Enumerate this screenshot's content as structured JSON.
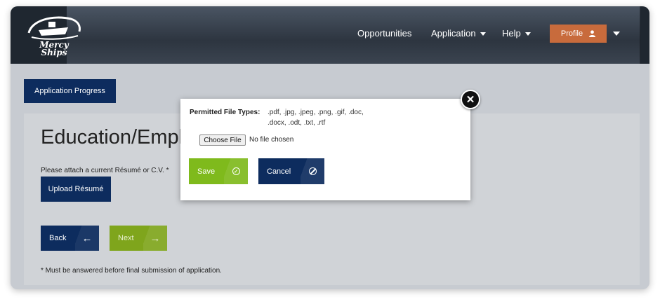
{
  "header": {
    "logo_text_line1": "Mercy",
    "logo_text_line2": "Ships",
    "nav": {
      "opportunities": "Opportunities",
      "application": "Application",
      "help": "Help"
    },
    "profile_label": "Profile",
    "profile_icon": "user-icon"
  },
  "main": {
    "progress_button": "Application Progress",
    "page_title": "Education/Employment",
    "attach_label": "Please attach a current Résumé or C.V. *",
    "upload_button": "Upload Résumé",
    "back_button": "Back",
    "next_button": "Next",
    "footnote": "* Must be answered before final submission of application."
  },
  "modal": {
    "file_types_label": "Permitted File Types:",
    "file_types_line1": ".pdf, .jpg, .jpeg, .png, .gif, .doc,",
    "file_types_line2": ".docx, .odt, .txt, .rtf",
    "choose_file": "Choose File",
    "no_file": "No file chosen",
    "save_button": "Save",
    "cancel_button": "Cancel"
  },
  "colors": {
    "navy": "#0d2c5e",
    "green": "#7fba1c",
    "orange": "#c86b3c",
    "header": "#1f2730"
  }
}
